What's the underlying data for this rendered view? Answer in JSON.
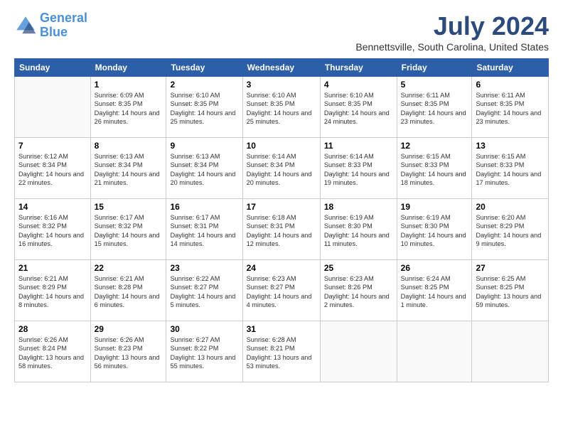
{
  "logo": {
    "line1": "General",
    "line2": "Blue"
  },
  "title": "July 2024",
  "subtitle": "Bennettsville, South Carolina, United States",
  "weekdays": [
    "Sunday",
    "Monday",
    "Tuesday",
    "Wednesday",
    "Thursday",
    "Friday",
    "Saturday"
  ],
  "weeks": [
    [
      {
        "day": "",
        "sunrise": "",
        "sunset": "",
        "daylight": ""
      },
      {
        "day": "1",
        "sunrise": "6:09 AM",
        "sunset": "8:35 PM",
        "daylight": "14 hours and 26 minutes."
      },
      {
        "day": "2",
        "sunrise": "6:10 AM",
        "sunset": "8:35 PM",
        "daylight": "14 hours and 25 minutes."
      },
      {
        "day": "3",
        "sunrise": "6:10 AM",
        "sunset": "8:35 PM",
        "daylight": "14 hours and 25 minutes."
      },
      {
        "day": "4",
        "sunrise": "6:10 AM",
        "sunset": "8:35 PM",
        "daylight": "14 hours and 24 minutes."
      },
      {
        "day": "5",
        "sunrise": "6:11 AM",
        "sunset": "8:35 PM",
        "daylight": "14 hours and 23 minutes."
      },
      {
        "day": "6",
        "sunrise": "6:11 AM",
        "sunset": "8:35 PM",
        "daylight": "14 hours and 23 minutes."
      }
    ],
    [
      {
        "day": "7",
        "sunrise": "6:12 AM",
        "sunset": "8:34 PM",
        "daylight": "14 hours and 22 minutes."
      },
      {
        "day": "8",
        "sunrise": "6:13 AM",
        "sunset": "8:34 PM",
        "daylight": "14 hours and 21 minutes."
      },
      {
        "day": "9",
        "sunrise": "6:13 AM",
        "sunset": "8:34 PM",
        "daylight": "14 hours and 20 minutes."
      },
      {
        "day": "10",
        "sunrise": "6:14 AM",
        "sunset": "8:34 PM",
        "daylight": "14 hours and 20 minutes."
      },
      {
        "day": "11",
        "sunrise": "6:14 AM",
        "sunset": "8:33 PM",
        "daylight": "14 hours and 19 minutes."
      },
      {
        "day": "12",
        "sunrise": "6:15 AM",
        "sunset": "8:33 PM",
        "daylight": "14 hours and 18 minutes."
      },
      {
        "day": "13",
        "sunrise": "6:15 AM",
        "sunset": "8:33 PM",
        "daylight": "14 hours and 17 minutes."
      }
    ],
    [
      {
        "day": "14",
        "sunrise": "6:16 AM",
        "sunset": "8:32 PM",
        "daylight": "14 hours and 16 minutes."
      },
      {
        "day": "15",
        "sunrise": "6:17 AM",
        "sunset": "8:32 PM",
        "daylight": "14 hours and 15 minutes."
      },
      {
        "day": "16",
        "sunrise": "6:17 AM",
        "sunset": "8:31 PM",
        "daylight": "14 hours and 14 minutes."
      },
      {
        "day": "17",
        "sunrise": "6:18 AM",
        "sunset": "8:31 PM",
        "daylight": "14 hours and 12 minutes."
      },
      {
        "day": "18",
        "sunrise": "6:19 AM",
        "sunset": "8:30 PM",
        "daylight": "14 hours and 11 minutes."
      },
      {
        "day": "19",
        "sunrise": "6:19 AM",
        "sunset": "8:30 PM",
        "daylight": "14 hours and 10 minutes."
      },
      {
        "day": "20",
        "sunrise": "6:20 AM",
        "sunset": "8:29 PM",
        "daylight": "14 hours and 9 minutes."
      }
    ],
    [
      {
        "day": "21",
        "sunrise": "6:21 AM",
        "sunset": "8:29 PM",
        "daylight": "14 hours and 8 minutes."
      },
      {
        "day": "22",
        "sunrise": "6:21 AM",
        "sunset": "8:28 PM",
        "daylight": "14 hours and 6 minutes."
      },
      {
        "day": "23",
        "sunrise": "6:22 AM",
        "sunset": "8:27 PM",
        "daylight": "14 hours and 5 minutes."
      },
      {
        "day": "24",
        "sunrise": "6:23 AM",
        "sunset": "8:27 PM",
        "daylight": "14 hours and 4 minutes."
      },
      {
        "day": "25",
        "sunrise": "6:23 AM",
        "sunset": "8:26 PM",
        "daylight": "14 hours and 2 minutes."
      },
      {
        "day": "26",
        "sunrise": "6:24 AM",
        "sunset": "8:25 PM",
        "daylight": "14 hours and 1 minute."
      },
      {
        "day": "27",
        "sunrise": "6:25 AM",
        "sunset": "8:25 PM",
        "daylight": "13 hours and 59 minutes."
      }
    ],
    [
      {
        "day": "28",
        "sunrise": "6:26 AM",
        "sunset": "8:24 PM",
        "daylight": "13 hours and 58 minutes."
      },
      {
        "day": "29",
        "sunrise": "6:26 AM",
        "sunset": "8:23 PM",
        "daylight": "13 hours and 56 minutes."
      },
      {
        "day": "30",
        "sunrise": "6:27 AM",
        "sunset": "8:22 PM",
        "daylight": "13 hours and 55 minutes."
      },
      {
        "day": "31",
        "sunrise": "6:28 AM",
        "sunset": "8:21 PM",
        "daylight": "13 hours and 53 minutes."
      },
      {
        "day": "",
        "sunrise": "",
        "sunset": "",
        "daylight": ""
      },
      {
        "day": "",
        "sunrise": "",
        "sunset": "",
        "daylight": ""
      },
      {
        "day": "",
        "sunrise": "",
        "sunset": "",
        "daylight": ""
      }
    ]
  ]
}
